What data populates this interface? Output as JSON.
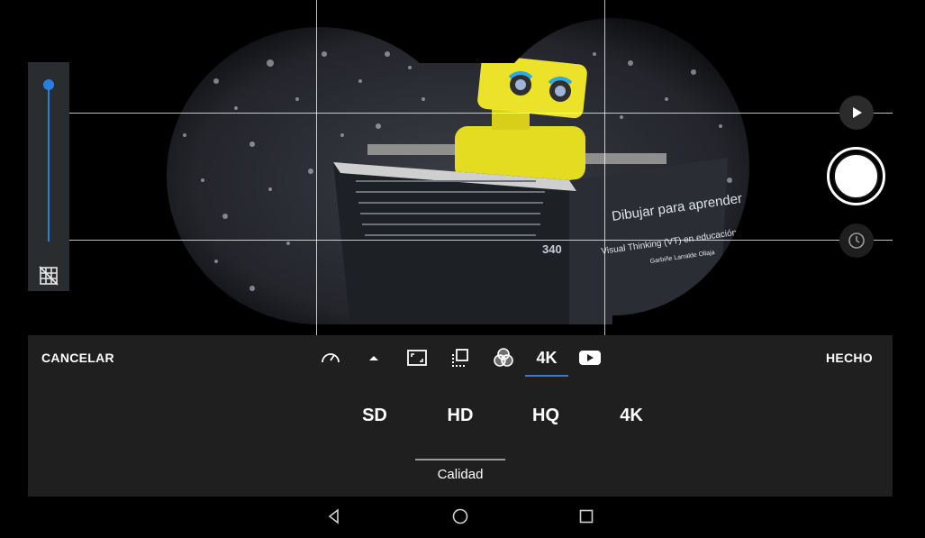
{
  "photo": {
    "book_page_number": "340",
    "book_title_line1": "Dibujar para aprender",
    "book_title_line2": "Visual Thinking (VT) en educación",
    "book_author": "Garbiñe Larralde Ollaja"
  },
  "zoom": {
    "level_fraction": 1.0
  },
  "camera_controls": {
    "play_icon": "play-icon",
    "shutter_icon": "shutter-button",
    "timer_icon": "clock-icon"
  },
  "settings_panel": {
    "cancel_label": "CANCELAR",
    "done_label": "HECHO",
    "tools": [
      {
        "icon": "speedometer-icon"
      },
      {
        "icon": "caret-up-icon"
      },
      {
        "icon": "aspect-ratio-icon"
      },
      {
        "icon": "frames-icon"
      },
      {
        "icon": "color-filter-icon"
      },
      {
        "label": "4K",
        "selected": true
      },
      {
        "icon": "youtube-icon"
      }
    ],
    "quality_options": [
      "SD",
      "HD",
      "HQ",
      "4K"
    ],
    "quality_label": "Calidad",
    "accent_color": "#2a7de1"
  },
  "navigation": {
    "back_icon": "back-icon",
    "home_icon": "home-icon",
    "recents_icon": "recents-icon"
  }
}
